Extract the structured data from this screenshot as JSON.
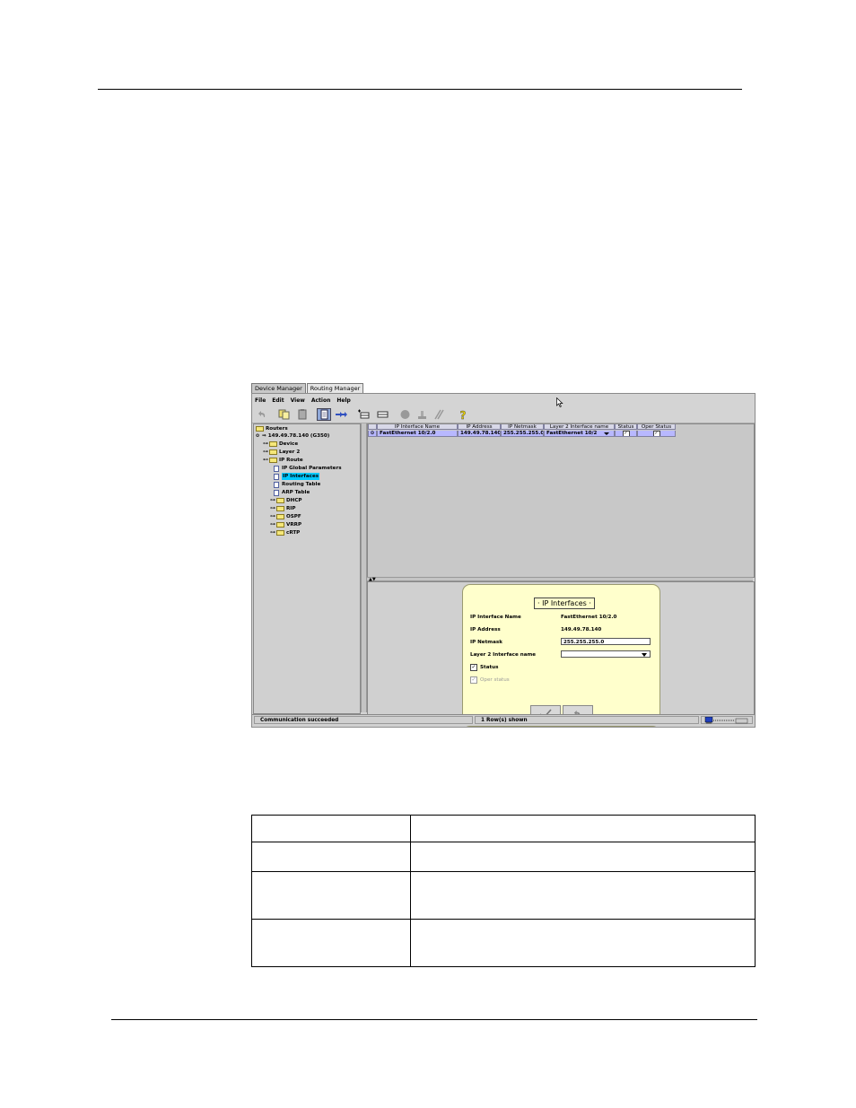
{
  "window": {
    "tabs": [
      "Device Manager",
      "Routing Manager"
    ],
    "active_tab": "Routing Manager",
    "menus": [
      "File",
      "Edit",
      "View",
      "Action",
      "Help"
    ]
  },
  "toolbar": {
    "icons": [
      "undo-icon",
      "copy-icon",
      "paste-icon",
      "page-icon",
      "forward-arrows-icon",
      "table-add-row-icon",
      "table-row-icon",
      "circle-icon",
      "stamp-icon",
      "slash-icon",
      "help-question-icon"
    ]
  },
  "tree": {
    "root": "Routers",
    "device": "149.49.78.140 (G350)",
    "device_children": [
      "Device",
      "Layer 2",
      "IP Route"
    ],
    "ip_route_children": [
      "IP Global Parameters",
      "IP Interfaces",
      "Routing Table",
      "ARP Table"
    ],
    "selected": "IP Interfaces",
    "folders_after": [
      "DHCP",
      "RIP",
      "OSPF",
      "VRRP",
      "cRTP"
    ]
  },
  "table": {
    "columns": [
      "IP Interface Name",
      "IP Address",
      "IP Netmask",
      "Layer 2 Interface name",
      "Status",
      "Oper Status"
    ],
    "rows": [
      {
        "name": "FastEthernet 10/2.0",
        "address": "149.49.78.140",
        "netmask": "255.255.255.0",
        "layer2": "FastEthernet 10/2",
        "status": "checked",
        "oper_status": "checked"
      }
    ]
  },
  "form": {
    "title": "IP Interfaces",
    "name_label": "IP Interface Name",
    "name_value": "FastEthernet 10/2.0",
    "address_label": "IP Address",
    "address_value": "149.49.78.140",
    "netmask_label": "IP Netmask",
    "netmask_value": "255.255.255.0",
    "layer2_label": "Layer 2 Interface name",
    "layer2_value": "",
    "status_label": "Status",
    "status_checked": true,
    "oper_label": "Oper status",
    "oper_checked": true
  },
  "statusbar": {
    "message": "Communication succeeded",
    "rows_shown": "1 Row(s) shown"
  },
  "colors": {
    "selection": "#00c8ff",
    "row_highlight": "#b8b8ff",
    "form_background": "#ffffcc"
  }
}
